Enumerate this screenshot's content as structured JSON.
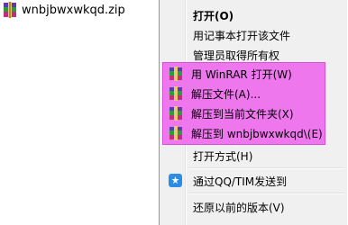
{
  "file": {
    "name": "wnbjbwxwkqd.zip",
    "icon": "winrar-archive-icon"
  },
  "menu": {
    "items": [
      {
        "label": "打开(O)"
      },
      {
        "label": "用记事本打开该文件"
      },
      {
        "label": "管理员取得所有权"
      },
      {
        "label": "用 WinRAR 打开(W)",
        "icon": "winrar-icon"
      },
      {
        "label": "解压文件(A)...",
        "icon": "winrar-icon"
      },
      {
        "label": "解压到当前文件夹(X)",
        "icon": "winrar-icon"
      },
      {
        "label": "解压到 wnbjbwxwkqd\\(E)",
        "icon": "winrar-icon"
      },
      {
        "label": "打开方式(H)"
      },
      {
        "label": "通过QQ/TIM发送到",
        "icon": "qq-share-icon"
      },
      {
        "label": "还原以前的版本(V)"
      }
    ]
  },
  "colors": {
    "highlight": "#ee77ee",
    "menu_bg": "#f0f0f0"
  }
}
